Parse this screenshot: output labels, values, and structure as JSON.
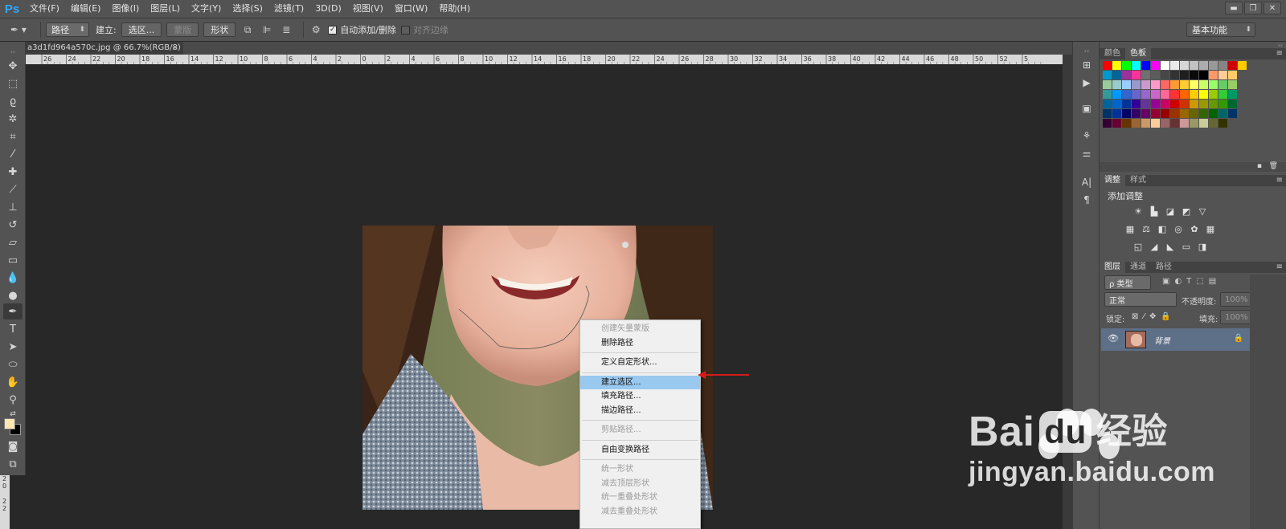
{
  "app": {
    "logo": "Ps",
    "menu": [
      "文件(F)",
      "编辑(E)",
      "图像(I)",
      "图层(L)",
      "文字(Y)",
      "选择(S)",
      "滤镜(T)",
      "3D(D)",
      "视图(V)",
      "窗口(W)",
      "帮助(H)"
    ]
  },
  "options_bar": {
    "mode_select": "路径",
    "make_label": "建立:",
    "selection_button": "选区...",
    "mask_button": "蒙版",
    "shape_button": "形状",
    "auto_add_delete_label": "自动添加/删除",
    "auto_add_delete_checked": true,
    "align_edges_label": "对齐边缘",
    "align_edges_checked": false,
    "workspace_select": "基本功能"
  },
  "document": {
    "tab_title": "a3d1fd964a570c.jpg @ 66.7%(RGB/8) *",
    "close": "×",
    "ruler_labels": [
      "26",
      "24",
      "22",
      "20",
      "18",
      "16",
      "14",
      "12",
      "10",
      "8",
      "6",
      "4",
      "2",
      "0",
      "2",
      "4",
      "6",
      "8",
      "10",
      "12",
      "14",
      "16",
      "18",
      "20",
      "22",
      "24",
      "26",
      "28",
      "30",
      "32",
      "34",
      "36",
      "38",
      "40",
      "42",
      "44",
      "46",
      "48",
      "50",
      "52",
      "5"
    ],
    "left_ruler_labels": [
      "2",
      "0",
      "2",
      "2"
    ]
  },
  "context_menu": {
    "items": [
      {
        "label": "创建矢量蒙版",
        "enabled": false
      },
      {
        "label": "删除路径",
        "enabled": true
      },
      {
        "sep": true
      },
      {
        "label": "定义自定形状...",
        "enabled": true
      },
      {
        "sep": true
      },
      {
        "label": "建立选区...",
        "enabled": true,
        "highlighted": true
      },
      {
        "label": "填充路径...",
        "enabled": true
      },
      {
        "label": "描边路径...",
        "enabled": true
      },
      {
        "sep": true
      },
      {
        "label": "剪贴路径...",
        "enabled": false
      },
      {
        "sep": true
      },
      {
        "label": "自由变换路径",
        "enabled": true
      },
      {
        "sep": true
      },
      {
        "label": "统一形状",
        "enabled": false
      },
      {
        "label": "减去顶层形状",
        "enabled": false
      },
      {
        "label": "统一重叠处形状",
        "enabled": false
      },
      {
        "label": "减去重叠处形状",
        "enabled": false
      }
    ]
  },
  "swatches_panel": {
    "tabs": [
      "颜色",
      "色板"
    ],
    "active_tab": "色板",
    "rows": [
      [
        "#ff0000",
        "#ffff00",
        "#00ff00",
        "#00ffff",
        "#0000ff",
        "#ff00ff",
        "#ffffff",
        "#ebebeb",
        "#d6d6d6",
        "#c2c2c2",
        "#adadad",
        "#999999",
        "#858585",
        "#cc0000",
        "#ffcc00"
      ],
      [
        "#0099cc",
        "#006699",
        "#993399",
        "#ff3399",
        "#707070",
        "#5c5c5c",
        "#474747",
        "#333333",
        "#1f1f1f",
        "#0a0a0a",
        "#000000",
        "#ff9966",
        "#ffcc99",
        "#ffcc66"
      ],
      [
        "#99cc99",
        "#99cccc",
        "#99ccff",
        "#9999cc",
        "#cc99cc",
        "#ff99cc",
        "#ff6666",
        "#ff9933",
        "#ffcc33",
        "#ffff66",
        "#ccff66",
        "#99ff66",
        "#66cc66",
        "#99cc66"
      ],
      [
        "#339999",
        "#0099ff",
        "#3366cc",
        "#6666cc",
        "#9966cc",
        "#cc66cc",
        "#ff6699",
        "#ff3333",
        "#ff6600",
        "#ffcc00",
        "#ffff00",
        "#99cc00",
        "#33cc33",
        "#009966"
      ],
      [
        "#006699",
        "#0066cc",
        "#003399",
        "#330099",
        "#663399",
        "#990099",
        "#cc0066",
        "#cc0000",
        "#cc3300",
        "#cc9900",
        "#999900",
        "#669900",
        "#339900",
        "#006633"
      ],
      [
        "#003366",
        "#003399",
        "#000066",
        "#330066",
        "#660066",
        "#990033",
        "#990000",
        "#993300",
        "#996600",
        "#666600",
        "#336600",
        "#006600",
        "#006666",
        "#003366"
      ],
      [
        "#330033",
        "#660033",
        "#663300",
        "#996633",
        "#cc9966",
        "#ffcc99",
        "#996666",
        "#663333",
        "#cc9999",
        "#999966",
        "#cccc99",
        "#666633",
        "#333300"
      ]
    ]
  },
  "adjustments_panel": {
    "tabs": [
      "调整",
      "样式"
    ],
    "active_tab": "调整",
    "title": "添加调整"
  },
  "layers_panel": {
    "tabs": [
      "图层",
      "通道",
      "路径"
    ],
    "active_tab": "图层",
    "filter_select": "ρ 类型",
    "blend_mode": "正常",
    "opacity_label": "不透明度:",
    "opacity_value": "100%",
    "lock_label": "锁定:",
    "fill_label": "填充:",
    "fill_value": "100%",
    "layer_name": "背景"
  },
  "watermark": {
    "brand": "Bai",
    "brand_du": "du",
    "suffix": "经验",
    "url": "jingyan.baidu.com"
  }
}
